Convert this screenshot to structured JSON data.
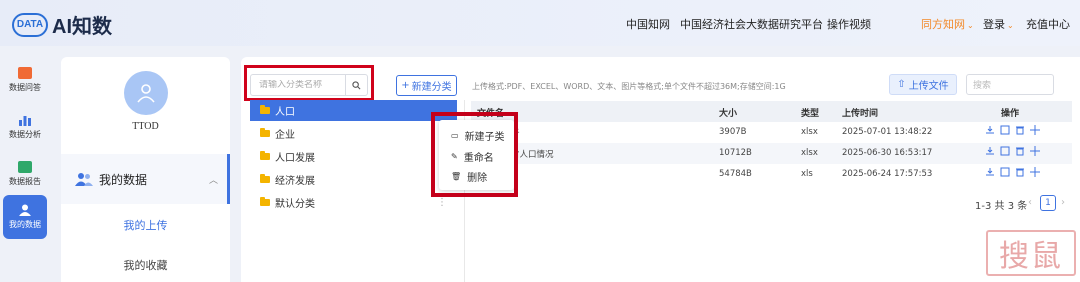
{
  "header": {
    "logo_badge": "DATA",
    "logo_text": "AI知数",
    "nav": [
      "中国知网",
      "中国经济社会大数据研究平台",
      "操作视频"
    ],
    "brand_link": "同方知网",
    "login": "登录",
    "recharge": "充值中心"
  },
  "rail": [
    {
      "label": "数据问答",
      "icon": "chat-icon",
      "color": "#f06a35"
    },
    {
      "label": "数据分析",
      "icon": "bar-chart-icon",
      "color": "#3f73e0"
    },
    {
      "label": "数据报告",
      "icon": "report-icon",
      "color": "#2fa86a"
    },
    {
      "label": "我的数据",
      "icon": "user-data-icon",
      "color": "#ffffff"
    }
  ],
  "sidebar": {
    "username": "TTOD",
    "section": "我的数据",
    "items": [
      "我的上传",
      "我的收藏"
    ]
  },
  "toolbar": {
    "category_search_placeholder": "请输入分类名称",
    "new_category": "新建分类",
    "hint": "上传格式:PDF、EXCEL、WORD、文本、图片等格式;单个文件不超过36M;存储空间:1G",
    "upload": "上传文件",
    "search_placeholder": "搜索"
  },
  "categories": [
    "人口",
    "企业",
    "人口发展",
    "经济发展",
    "默认分类"
  ],
  "context_menu": [
    "新建子类",
    "重命名",
    "删除"
  ],
  "table": {
    "headers": {
      "name": "文件名",
      "size": "大小",
      "type": "类型",
      "time": "上传时间",
      "ops": "操作"
    },
    "rows": [
      {
        "name": "析",
        "size": "3907B",
        "type": "xlsx",
        "time": "2025-07-01 13:48:22"
      },
      {
        "name": "省人口情况",
        "size": "10712B",
        "type": "xlsx",
        "time": "2025-06-30 16:53:17"
      },
      {
        "name": "",
        "size": "54784B",
        "type": "xls",
        "time": "2025-06-24 17:57:53"
      }
    ]
  },
  "pagination": {
    "summary": "1-3 共 3 条",
    "current": "1"
  },
  "watermark": "搜鼠"
}
